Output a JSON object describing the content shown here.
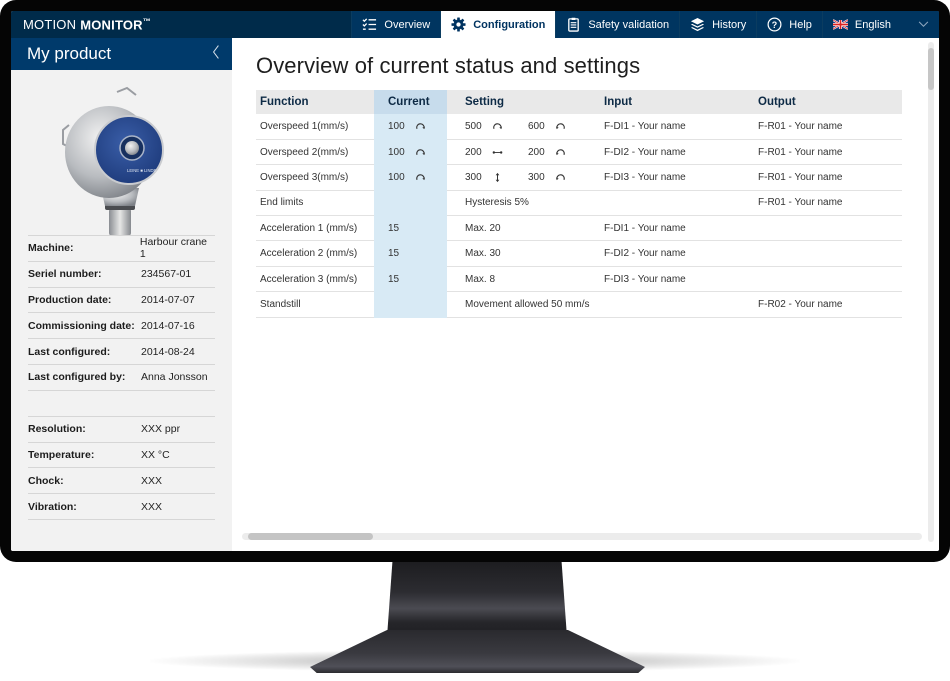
{
  "app": {
    "brand_light": "MOTION",
    "brand_bold": "MONITOR",
    "brand_mark": "™"
  },
  "nav": [
    {
      "label": "Overview",
      "icon": "checklist-icon",
      "active": false
    },
    {
      "label": "Configuration",
      "icon": "gear-icon",
      "active": true
    },
    {
      "label": "Safety validation",
      "icon": "clipboard-icon",
      "active": false
    },
    {
      "label": "History",
      "icon": "layers-icon",
      "active": false
    },
    {
      "label": "Help",
      "icon": "question-circle-icon",
      "active": false
    },
    {
      "label": "English",
      "icon": "uk-flag-icon",
      "active": false,
      "dropdown": true
    }
  ],
  "sidebar": {
    "title": "My product",
    "back_glyph": "‹",
    "product_brand": "LEINE ■ LINDE",
    "details": [
      {
        "label": "Machine:",
        "value": "Harbour crane 1"
      },
      {
        "label": "Seriel number:",
        "value": "234567-01"
      },
      {
        "label": "Production date:",
        "value": "2014-07-07"
      },
      {
        "label": "Commissioning date:",
        "value": "2014-07-16"
      },
      {
        "label": "Last configured:",
        "value": "2014-08-24"
      },
      {
        "label": "Last configured by:",
        "value": "Anna Jonsson"
      }
    ],
    "status": [
      {
        "label": "Resolution:",
        "value": "XXX ppr"
      },
      {
        "label": "Temperature:",
        "value": "XX °C"
      },
      {
        "label": "Chock:",
        "value": "XXX"
      },
      {
        "label": "Vibration:",
        "value": "XXX"
      }
    ]
  },
  "main": {
    "title": "Overview of current status and settings",
    "columns": [
      "Function",
      "Current",
      "Setting",
      "",
      "Input",
      "Output"
    ],
    "rows": [
      {
        "function": "Overspeed 1(mm/s)",
        "current": "100",
        "current_icon": "rotate-cw",
        "setting1": "500",
        "setting1_icon": "rotate-cw",
        "setting2": "600",
        "setting2_icon": "rotate-ccw",
        "input": "F-DI1 - Your name",
        "output": "F-R01 - Your name"
      },
      {
        "function": "Overspeed 2(mm/s)",
        "current": "100",
        "current_icon": "rotate-cw",
        "setting1": "200",
        "setting1_icon": "arrows-horizontal",
        "setting2": "200",
        "setting2_icon": "rotate-ccw",
        "input": "F-DI2 - Your name",
        "output": "F-R01 - Your name"
      },
      {
        "function": "Overspeed 3(mm/s)",
        "current": "100",
        "current_icon": "rotate-cw",
        "setting1": "300",
        "setting1_icon": "arrows-vertical",
        "setting2": "300",
        "setting2_icon": "rotate-ccw",
        "input": "F-DI3 - Your name",
        "output": "F-R01 - Your name"
      },
      {
        "function": "End limits",
        "current": "",
        "setting1": "Hysteresis 5%",
        "setting2": "",
        "input": "",
        "output": "F-R01 - Your name"
      },
      {
        "function": "Acceleration 1 (mm/s)",
        "current": "15",
        "setting1": "Max. 20",
        "setting2": "",
        "input": "F-DI1 - Your name",
        "output": ""
      },
      {
        "function": "Acceleration 2 (mm/s)",
        "current": "15",
        "setting1": "Max. 30",
        "setting2": "",
        "input": "F-DI2 - Your name",
        "output": ""
      },
      {
        "function": "Acceleration 3 (mm/s)",
        "current": "15",
        "setting1": "Max. 8",
        "setting2": "",
        "input": "F-DI3 - Your name",
        "output": ""
      },
      {
        "function": "Standstill",
        "current": "",
        "setting1": "Movement allowed 50 mm/s",
        "setting2": "",
        "input": "",
        "output": "F-R02 - Your name"
      }
    ]
  },
  "colors": {
    "topbar": "#002b4a",
    "sidebar_header": "#003a6b",
    "current_column": "#d8eaf5",
    "active_tab_text": "#003360"
  }
}
